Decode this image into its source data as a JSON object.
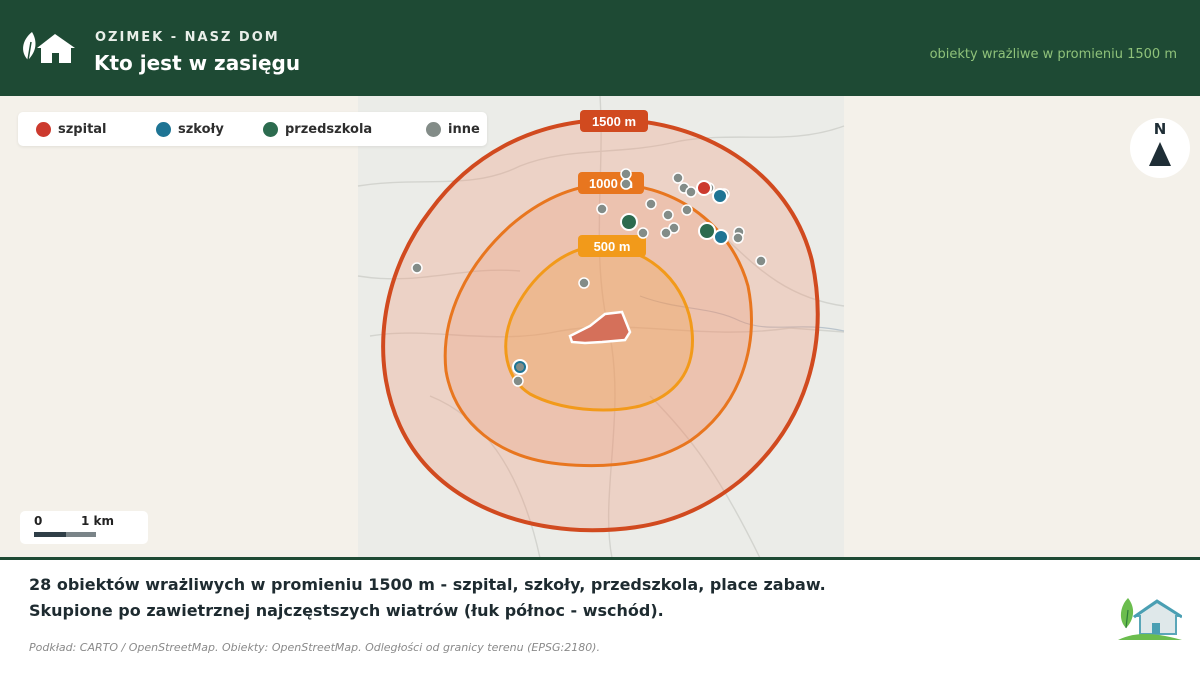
{
  "header": {
    "kicker": "OZIMEK - NASZ DOM",
    "title": "Kto jest w zasięgu",
    "subtitle": "obiekty wrażliwe w promieniu 1500 m"
  },
  "legend": {
    "items": [
      {
        "key": "hospital",
        "label": "szpital",
        "color": "#cc3a2e"
      },
      {
        "key": "school",
        "label": "szkoły",
        "color": "#1e7494"
      },
      {
        "key": "kindergarten",
        "label": "przedszkola",
        "color": "#2c6b4f"
      },
      {
        "key": "other",
        "label": "inne",
        "color": "#838c88"
      }
    ]
  },
  "rings": [
    {
      "label": "1500 m",
      "color": "#d14a1f"
    },
    {
      "label": "1000 m",
      "color": "#e8761f"
    },
    {
      "label": "500 m",
      "color": "#f29a1a"
    }
  ],
  "north": {
    "label": "N"
  },
  "scale": {
    "zero": "0",
    "km": "1 km"
  },
  "colors": {
    "header_bg": "#1e4a34",
    "accent_green": "#8fc27a",
    "site": "#d5705a"
  },
  "footer": {
    "line1": "28 obiektów wrażliwych w promieniu 1500 m - szpital, szkoły, przedszkola, place zabaw.",
    "line2": "Skupione po zawietrznej najczęstszych wiatrów (łuk północ - wschód).",
    "source": "Podkład: CARTO / OpenStreetMap. Obiekty: OpenStreetMap. Odległości od granicy terenu (EPSG:2180)."
  }
}
